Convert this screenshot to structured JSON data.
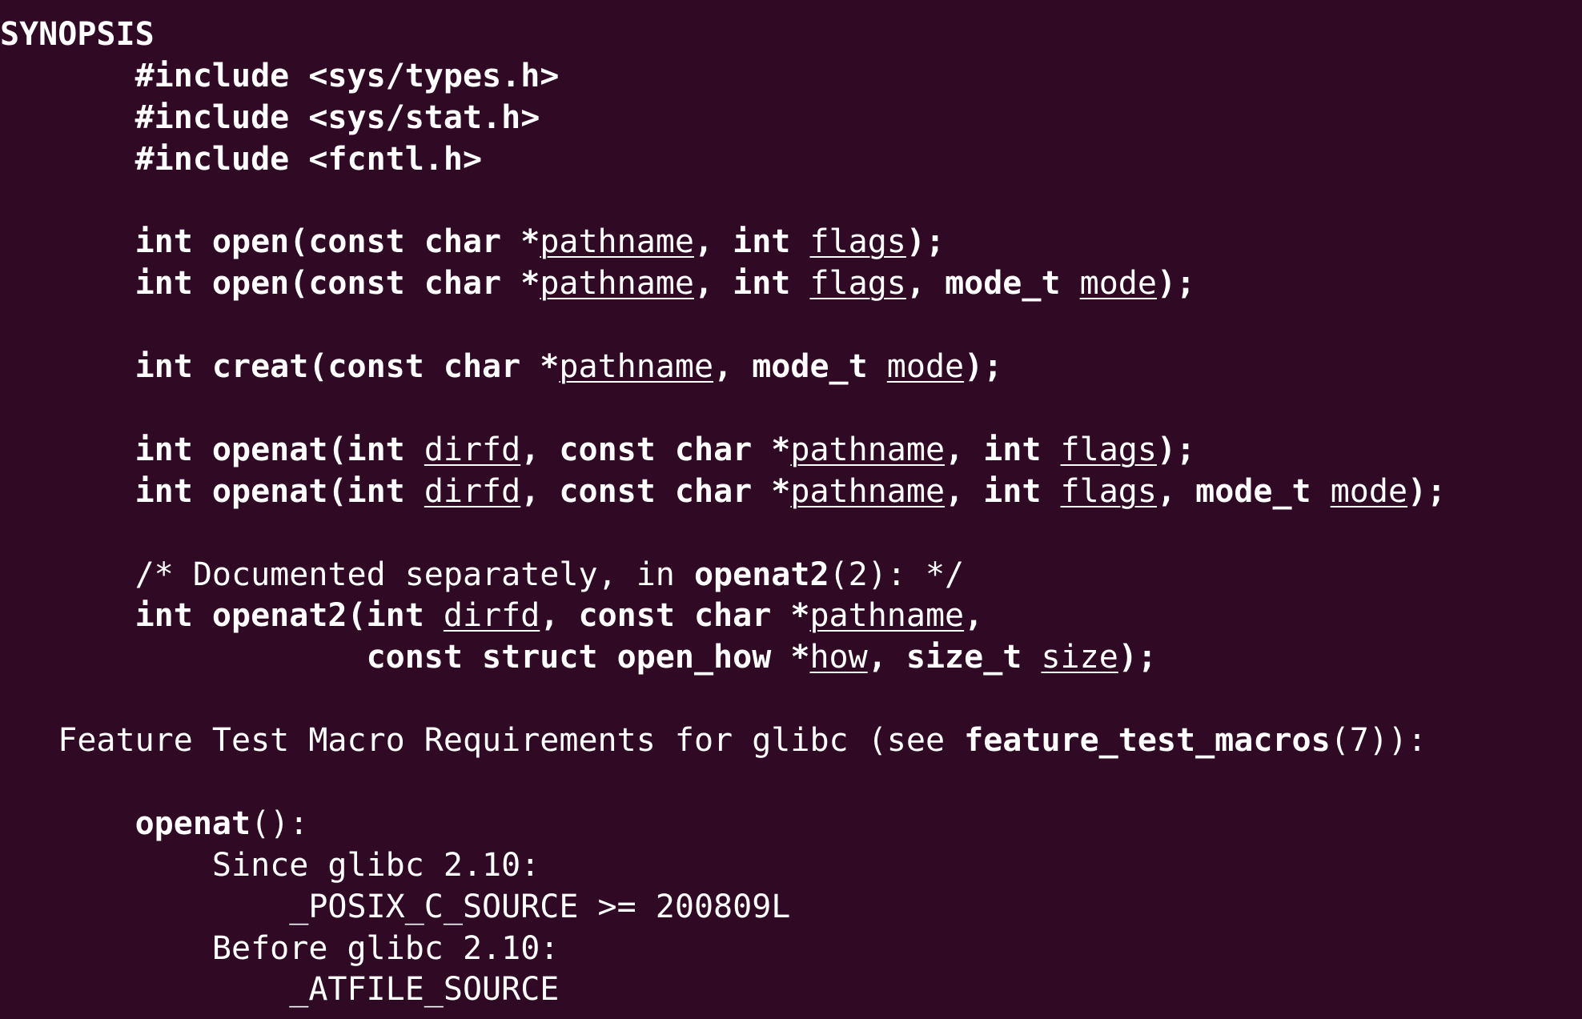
{
  "terminal": {
    "background": "#300a24",
    "foreground": "#ffffff",
    "lines": [
      [
        {
          "t": "SYNOPSIS",
          "b": true
        }
      ],
      [
        {
          "t": "       "
        },
        {
          "t": "#include <sys/types.h>",
          "b": true
        }
      ],
      [
        {
          "t": "       "
        },
        {
          "t": "#include <sys/stat.h>",
          "b": true
        }
      ],
      [
        {
          "t": "       "
        },
        {
          "t": "#include <fcntl.h>",
          "b": true
        }
      ],
      [],
      [
        {
          "t": "       "
        },
        {
          "t": "int open(const char *",
          "b": true
        },
        {
          "t": "pathname",
          "u": true
        },
        {
          "t": ", ",
          "b": true
        },
        {
          "t": "int ",
          "b": true
        },
        {
          "t": "flags",
          "u": true
        },
        {
          "t": ");",
          "b": true
        }
      ],
      [
        {
          "t": "       "
        },
        {
          "t": "int open(const char *",
          "b": true
        },
        {
          "t": "pathname",
          "u": true
        },
        {
          "t": ", ",
          "b": true
        },
        {
          "t": "int ",
          "b": true
        },
        {
          "t": "flags",
          "u": true
        },
        {
          "t": ", ",
          "b": true
        },
        {
          "t": "mode_t ",
          "b": true
        },
        {
          "t": "mode",
          "u": true
        },
        {
          "t": ");",
          "b": true
        }
      ],
      [],
      [
        {
          "t": "       "
        },
        {
          "t": "int creat(const char *",
          "b": true
        },
        {
          "t": "pathname",
          "u": true
        },
        {
          "t": ", ",
          "b": true
        },
        {
          "t": "mode_t ",
          "b": true
        },
        {
          "t": "mode",
          "u": true
        },
        {
          "t": ");",
          "b": true
        }
      ],
      [],
      [
        {
          "t": "       "
        },
        {
          "t": "int openat(int ",
          "b": true
        },
        {
          "t": "dirfd",
          "u": true
        },
        {
          "t": ", ",
          "b": true
        },
        {
          "t": "const char *",
          "b": true
        },
        {
          "t": "pathname",
          "u": true
        },
        {
          "t": ", ",
          "b": true
        },
        {
          "t": "int ",
          "b": true
        },
        {
          "t": "flags",
          "u": true
        },
        {
          "t": ");",
          "b": true
        }
      ],
      [
        {
          "t": "       "
        },
        {
          "t": "int openat(int ",
          "b": true
        },
        {
          "t": "dirfd",
          "u": true
        },
        {
          "t": ", ",
          "b": true
        },
        {
          "t": "const char *",
          "b": true
        },
        {
          "t": "pathname",
          "u": true
        },
        {
          "t": ", ",
          "b": true
        },
        {
          "t": "int ",
          "b": true
        },
        {
          "t": "flags",
          "u": true
        },
        {
          "t": ", ",
          "b": true
        },
        {
          "t": "mode_t ",
          "b": true
        },
        {
          "t": "mode",
          "u": true
        },
        {
          "t": ");",
          "b": true
        }
      ],
      [],
      [
        {
          "t": "       "
        },
        {
          "t": "/* Documented separately, in "
        },
        {
          "t": "openat2",
          "b": true
        },
        {
          "t": "(2): */"
        }
      ],
      [
        {
          "t": "       "
        },
        {
          "t": "int openat2(int ",
          "b": true
        },
        {
          "t": "dirfd",
          "u": true
        },
        {
          "t": ", ",
          "b": true
        },
        {
          "t": "const char *",
          "b": true
        },
        {
          "t": "pathname",
          "u": true
        },
        {
          "t": ",",
          "b": true
        }
      ],
      [
        {
          "t": "                   "
        },
        {
          "t": "const struct open_how *",
          "b": true
        },
        {
          "t": "how",
          "u": true
        },
        {
          "t": ", ",
          "b": true
        },
        {
          "t": "size_t ",
          "b": true
        },
        {
          "t": "size",
          "u": true
        },
        {
          "t": ");",
          "b": true
        }
      ],
      [],
      [
        {
          "t": "   Feature Test Macro Requirements for glibc (see "
        },
        {
          "t": "feature_test_macros",
          "b": true
        },
        {
          "t": "(7)):"
        }
      ],
      [],
      [
        {
          "t": "       "
        },
        {
          "t": "openat",
          "b": true
        },
        {
          "t": "():"
        }
      ],
      [
        {
          "t": "           Since glibc 2.10:"
        }
      ],
      [
        {
          "t": "               _POSIX_C_SOURCE >= 200809L"
        }
      ],
      [
        {
          "t": "           Before glibc 2.10:"
        }
      ],
      [
        {
          "t": "               _ATFILE_SOURCE"
        }
      ]
    ]
  }
}
